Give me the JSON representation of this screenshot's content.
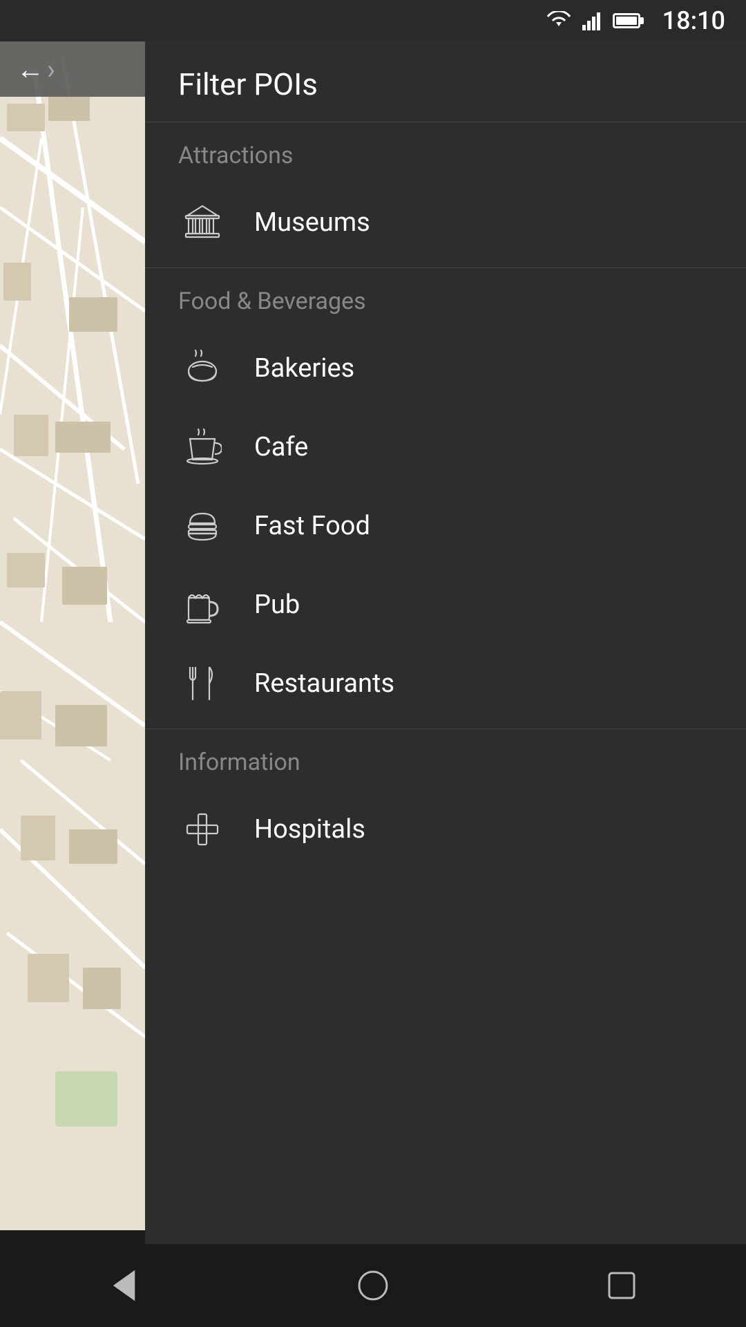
{
  "statusBar": {
    "time": "18:10"
  },
  "header": {
    "title": "Filter POIs",
    "backLabel": "back"
  },
  "sections": [
    {
      "id": "attractions",
      "label": "Attractions",
      "items": [
        {
          "id": "museums",
          "label": "Museums",
          "icon": "museum-icon"
        }
      ]
    },
    {
      "id": "food-beverages",
      "label": "Food & Beverages",
      "items": [
        {
          "id": "bakeries",
          "label": "Bakeries",
          "icon": "bakery-icon"
        },
        {
          "id": "cafe",
          "label": "Cafe",
          "icon": "cafe-icon"
        },
        {
          "id": "fast-food",
          "label": "Fast Food",
          "icon": "fast-food-icon"
        },
        {
          "id": "pub",
          "label": "Pub",
          "icon": "pub-icon"
        },
        {
          "id": "restaurants",
          "label": "Restaurants",
          "icon": "restaurant-icon"
        }
      ]
    },
    {
      "id": "information",
      "label": "Information",
      "items": [
        {
          "id": "hospitals",
          "label": "Hospitals",
          "icon": "hospital-icon"
        }
      ]
    }
  ],
  "navBar": {
    "back": "back-nav-icon",
    "home": "home-nav-icon",
    "recents": "recents-nav-icon"
  }
}
